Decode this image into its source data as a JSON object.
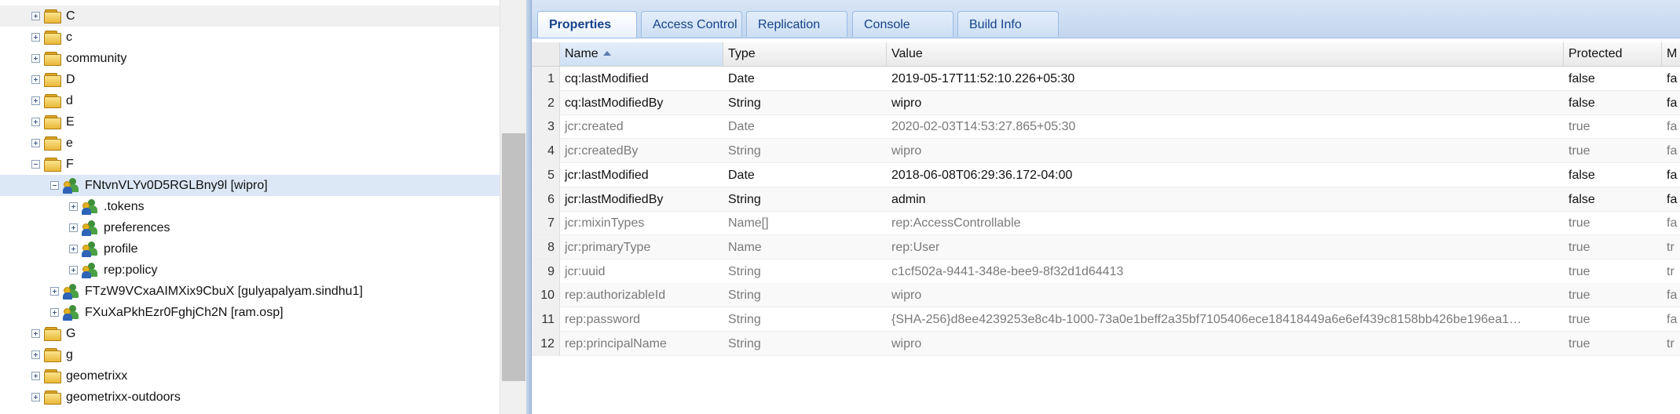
{
  "tree": {
    "items": [
      {
        "label": "C",
        "kind": "folder",
        "expanded": false,
        "level": 0
      },
      {
        "label": "c",
        "kind": "folder",
        "expanded": false,
        "level": 0
      },
      {
        "label": "community",
        "kind": "folder",
        "expanded": false,
        "level": 0
      },
      {
        "label": "D",
        "kind": "folder",
        "expanded": false,
        "level": 0
      },
      {
        "label": "d",
        "kind": "folder",
        "expanded": false,
        "level": 0
      },
      {
        "label": "E",
        "kind": "folder",
        "expanded": false,
        "level": 0
      },
      {
        "label": "e",
        "kind": "folder",
        "expanded": false,
        "level": 0
      },
      {
        "label": "F",
        "kind": "folder",
        "expanded": true,
        "level": 0
      },
      {
        "label": "FNtvnVLYv0D5RGLBny9l [wipro]",
        "kind": "user",
        "expanded": true,
        "level": 1,
        "selected": true
      },
      {
        "label": ".tokens",
        "kind": "user",
        "expanded": false,
        "level": 2
      },
      {
        "label": "preferences",
        "kind": "user",
        "expanded": false,
        "level": 2
      },
      {
        "label": "profile",
        "kind": "user",
        "expanded": false,
        "level": 2
      },
      {
        "label": "rep:policy",
        "kind": "user",
        "expanded": false,
        "level": 2
      },
      {
        "label": "FTzW9VCxaAIMXix9CbuX [gulyapalyam.sindhu1]",
        "kind": "user",
        "expanded": false,
        "level": 1
      },
      {
        "label": "FXuXaPkhEzr0FghjCh2N [ram.osp]",
        "kind": "user",
        "expanded": false,
        "level": 1
      },
      {
        "label": "G",
        "kind": "folder",
        "expanded": false,
        "level": 0
      },
      {
        "label": "g",
        "kind": "folder",
        "expanded": false,
        "level": 0
      },
      {
        "label": "geometrixx",
        "kind": "folder",
        "expanded": false,
        "level": 0
      },
      {
        "label": "geometrixx-outdoors",
        "kind": "folder",
        "expanded": false,
        "level": 0
      }
    ]
  },
  "tabs": [
    {
      "label": "Properties",
      "active": true
    },
    {
      "label": "Access Control",
      "active": false
    },
    {
      "label": "Replication",
      "active": false
    },
    {
      "label": "Console",
      "active": false
    },
    {
      "label": "Build Info",
      "active": false
    }
  ],
  "grid": {
    "columns": [
      "Name",
      "Type",
      "Value",
      "Protected",
      "M"
    ],
    "sorted_column": "Name",
    "rows": [
      {
        "n": "1",
        "name": "cq:lastModified",
        "type": "Date",
        "value": "2019-05-17T11:52:10.226+05:30",
        "protected": "false",
        "m": "fa",
        "dim": false
      },
      {
        "n": "2",
        "name": "cq:lastModifiedBy",
        "type": "String",
        "value": "wipro",
        "protected": "false",
        "m": "fa",
        "dim": false
      },
      {
        "n": "3",
        "name": "jcr:created",
        "type": "Date",
        "value": "2020-02-03T14:53:27.865+05:30",
        "protected": "true",
        "m": "fa",
        "dim": true
      },
      {
        "n": "4",
        "name": "jcr:createdBy",
        "type": "String",
        "value": "wipro",
        "protected": "true",
        "m": "fa",
        "dim": true
      },
      {
        "n": "5",
        "name": "jcr:lastModified",
        "type": "Date",
        "value": "2018-06-08T06:29:36.172-04:00",
        "protected": "false",
        "m": "fa",
        "dim": false
      },
      {
        "n": "6",
        "name": "jcr:lastModifiedBy",
        "type": "String",
        "value": "admin",
        "protected": "false",
        "m": "fa",
        "dim": false
      },
      {
        "n": "7",
        "name": "jcr:mixinTypes",
        "type": "Name[]",
        "value": "rep:AccessControllable",
        "protected": "true",
        "m": "fa",
        "dim": true
      },
      {
        "n": "8",
        "name": "jcr:primaryType",
        "type": "Name",
        "value": "rep:User",
        "protected": "true",
        "m": "tr",
        "dim": true
      },
      {
        "n": "9",
        "name": "jcr:uuid",
        "type": "String",
        "value": "c1cf502a-9441-348e-bee9-8f32d1d64413",
        "protected": "true",
        "m": "tr",
        "dim": true
      },
      {
        "n": "10",
        "name": "rep:authorizableId",
        "type": "String",
        "value": "wipro",
        "protected": "true",
        "m": "fa",
        "dim": true
      },
      {
        "n": "11",
        "name": "rep:password",
        "type": "String",
        "value": "{SHA-256}d8ee4239253e8c4b-1000-73a0e1beff2a35bf7105406ece18418449a6e6ef439c8158bb426be196ea1…",
        "protected": "true",
        "m": "fa",
        "dim": true
      },
      {
        "n": "12",
        "name": "rep:principalName",
        "type": "String",
        "value": "wipro",
        "protected": "true",
        "m": "tr",
        "dim": true
      }
    ]
  }
}
